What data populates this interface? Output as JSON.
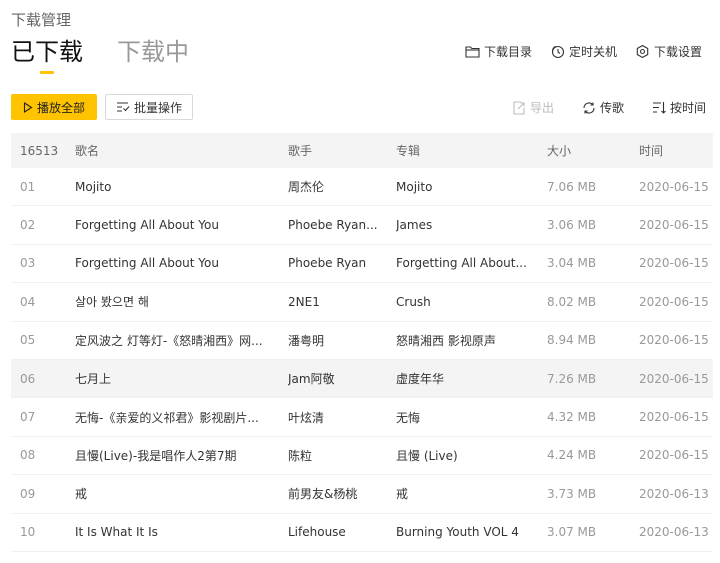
{
  "page": {
    "title": "下载管理"
  },
  "tabs": [
    {
      "label": "已下载",
      "active": true
    },
    {
      "label": "下载中",
      "active": false
    }
  ],
  "top_actions": [
    {
      "label": "下载目录",
      "icon": "folder-icon"
    },
    {
      "label": "定时关机",
      "icon": "timer-icon"
    },
    {
      "label": "下载设置",
      "icon": "settings-icon"
    }
  ],
  "toolbar": {
    "play_all": "播放全部",
    "batch": "批量操作"
  },
  "right_tools": {
    "export": "导出",
    "transfer": "传歌",
    "sort": "按时间"
  },
  "table": {
    "headers": {
      "count": "16513",
      "name": "歌名",
      "artist": "歌手",
      "album": "专辑",
      "size": "大小",
      "time": "时间"
    },
    "rows": [
      {
        "idx": "01",
        "name": "Mojito",
        "artist": "周杰伦",
        "album": "Mojito",
        "size": "7.06 MB",
        "time": "2020-06-15"
      },
      {
        "idx": "02",
        "name": "Forgetting All About You",
        "artist": "Phoebe Ryan...",
        "album": "James",
        "size": "3.06 MB",
        "time": "2020-06-15"
      },
      {
        "idx": "03",
        "name": "Forgetting All About You",
        "artist": "Phoebe Ryan",
        "album": "Forgetting All About...",
        "size": "3.04 MB",
        "time": "2020-06-15"
      },
      {
        "idx": "04",
        "name": "살아 봤으면 해",
        "artist": "2NE1",
        "album": "Crush",
        "size": "8.02 MB",
        "time": "2020-06-15"
      },
      {
        "idx": "05",
        "name": "定风波之 灯等灯-《怒晴湘西》网...",
        "artist": "潘粤明",
        "album": "怒晴湘西 影视原声",
        "size": "8.94 MB",
        "time": "2020-06-15"
      },
      {
        "idx": "06",
        "name": "七月上",
        "artist": "Jam阿敬",
        "album": "虚度年华",
        "size": "7.26 MB",
        "time": "2020-06-15"
      },
      {
        "idx": "07",
        "name": "无悔-《亲爱的义祁君》影视剧片...",
        "artist": "叶炫清",
        "album": "无悔",
        "size": "4.32 MB",
        "time": "2020-06-15"
      },
      {
        "idx": "08",
        "name": "且慢(Live)-我是唱作人2第7期",
        "artist": "陈粒",
        "album": "且慢 (Live)",
        "size": "4.24 MB",
        "time": "2020-06-15"
      },
      {
        "idx": "09",
        "name": "戒",
        "artist": "前男友&杨桃",
        "album": "戒",
        "size": "3.73 MB",
        "time": "2020-06-13"
      },
      {
        "idx": "10",
        "name": "It Is What It Is",
        "artist": "Lifehouse",
        "album": "Burning Youth VOL 4",
        "size": "3.07 MB",
        "time": "2020-06-13"
      }
    ]
  },
  "colors": {
    "accent": "#ffc300",
    "header_bg": "#f4f4f4",
    "muted": "#999999"
  }
}
